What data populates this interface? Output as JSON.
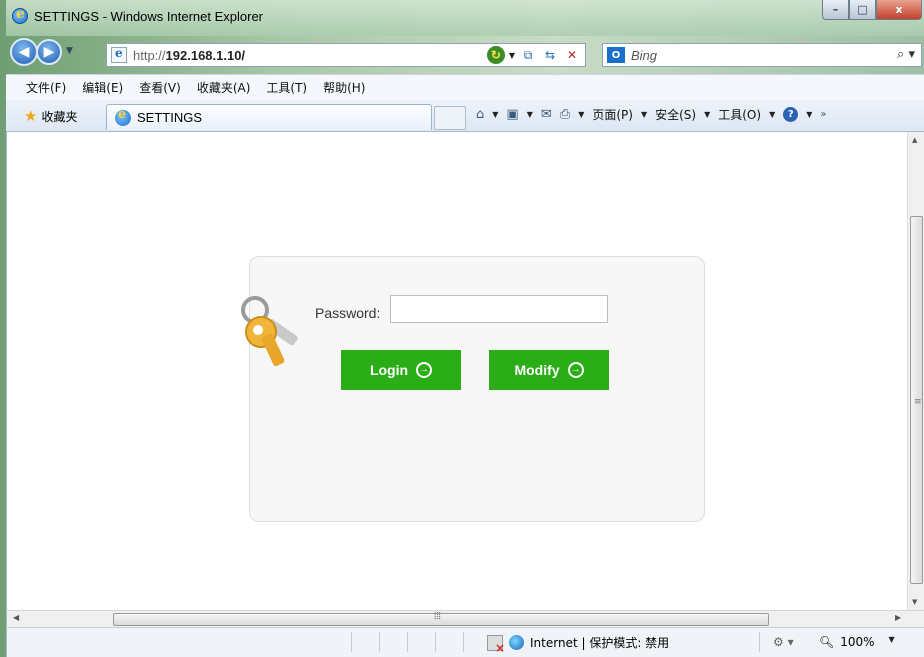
{
  "window": {
    "title": "SETTINGS - Windows Internet Explorer",
    "minimize": "–",
    "maximize": "□",
    "close": "x"
  },
  "address": {
    "url_prefix": "http://",
    "url_host": "192.168.1.10/",
    "search_placeholder": "Bing"
  },
  "menu": {
    "items": [
      "文件(F)",
      "编辑(E)",
      "查看(V)",
      "收藏夹(A)",
      "工具(T)",
      "帮助(H)"
    ]
  },
  "favorites": {
    "label": "收藏夹"
  },
  "tab": {
    "label": "SETTINGS"
  },
  "command_bar": {
    "page": "页面(P)",
    "safety": "安全(S)",
    "tools": "工具(O)",
    "help_icon": "?"
  },
  "login": {
    "password_label": "Password:",
    "password_value": "",
    "login_button": "Login",
    "modify_button": "Modify",
    "accent_color": "#2bad17"
  },
  "status": {
    "zone": "Internet | 保护模式: 禁用",
    "zoom": "100%"
  }
}
